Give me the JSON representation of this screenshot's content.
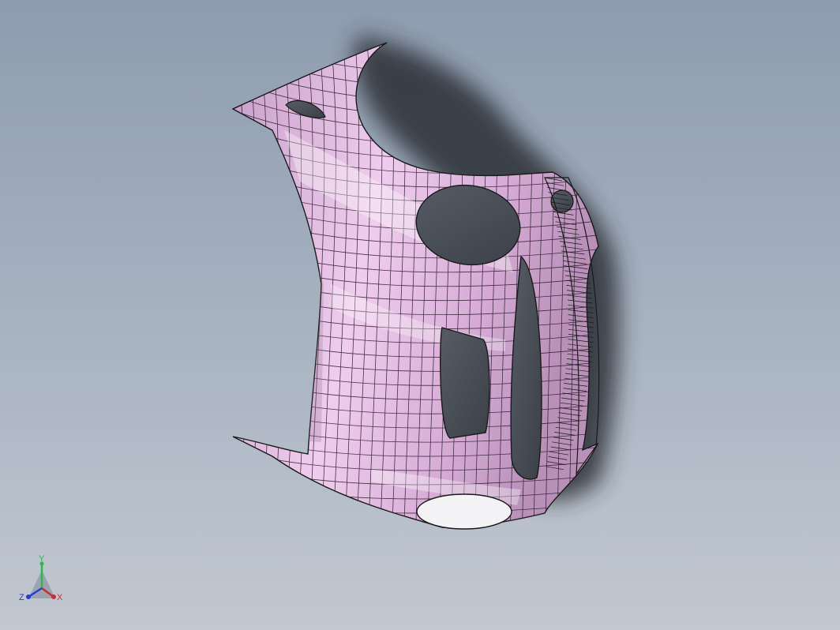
{
  "viewport": {
    "background_top": "#8e9caf",
    "background_bottom": "#c2c8d1",
    "part_color": "#e2b8e0",
    "part_shade_color": "#b88fb8",
    "edge_color": "#1a1a1a",
    "shadow_color": "#2a2f36"
  },
  "triad": {
    "x_label": "X",
    "y_label": "Y",
    "z_label": "Z",
    "x_color": "#d42a2a",
    "y_color": "#2fb84a",
    "z_color": "#2a3ad4"
  }
}
